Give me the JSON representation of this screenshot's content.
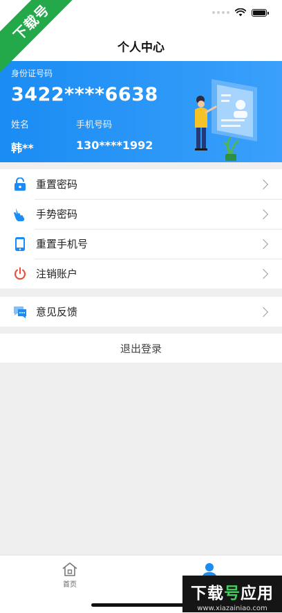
{
  "corner_badge": "下载号",
  "nav": {
    "title": "个人中心"
  },
  "card": {
    "id_label": "身份证号码",
    "id_number": "3422****6638",
    "name_label": "姓名",
    "phone_label": "手机号码",
    "name_value": "韩**",
    "phone_value": "130****1992"
  },
  "menu_group_1": [
    {
      "label": "重置密码",
      "icon": "lock-icon"
    },
    {
      "label": "手势密码",
      "icon": "hand-gesture-icon"
    },
    {
      "label": "重置手机号",
      "icon": "phone-icon"
    },
    {
      "label": "注销账户",
      "icon": "power-icon"
    }
  ],
  "menu_group_2": [
    {
      "label": "意见反馈",
      "icon": "feedback-icon"
    }
  ],
  "logout": {
    "label": "退出登录"
  },
  "tab_bar": {
    "home_label": "首页"
  },
  "watermark": {
    "main_1": "下载",
    "main_accent": "号",
    "main_2": "应用",
    "url": "www.xiazainiao.com"
  },
  "colors": {
    "accent": "#1a8cf3",
    "power_icon": "#e5533d"
  }
}
